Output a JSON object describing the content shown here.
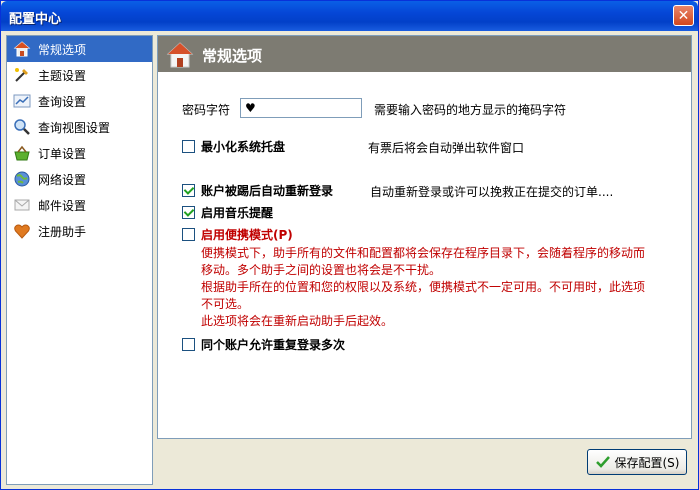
{
  "window": {
    "title": "配置中心",
    "close_glyph": "✕"
  },
  "sidebar": {
    "items": [
      {
        "label": "常规选项",
        "icon": "home-icon",
        "selected": true
      },
      {
        "label": "主题设置",
        "icon": "brush-icon"
      },
      {
        "label": "查询设置",
        "icon": "chart-icon"
      },
      {
        "label": "查询视图设置",
        "icon": "magnifier-icon"
      },
      {
        "label": "订单设置",
        "icon": "basket-icon"
      },
      {
        "label": "网络设置",
        "icon": "globe-icon"
      },
      {
        "label": "邮件设置",
        "icon": "envelope-icon"
      },
      {
        "label": "注册助手",
        "icon": "heart-icon"
      }
    ]
  },
  "panel": {
    "title": "常规选项",
    "password": {
      "label": "密码字符",
      "value": "♥",
      "description": "需要输入密码的地方显示的掩码字符"
    },
    "minimize_tray": {
      "label": "最小化系统托盘",
      "checked": false,
      "description": "有票后将会自动弹出软件窗口"
    },
    "auto_relogin": {
      "label": "账户被踢后自动重新登录",
      "checked": true,
      "description": "自动重新登录或许可以挽救正在提交的订单...."
    },
    "music_alert": {
      "label": "启用音乐提醒",
      "checked": true
    },
    "portable_mode": {
      "label": "启用便携模式(P)",
      "checked": false,
      "description": [
        "便携模式下，助手所有的文件和配置都将会保存在程序目录下，会随着程序的移动而",
        "移动。多个助手之间的设置也将会是不干扰。",
        "根据助手所在的位置和您的权限以及系统，便携模式不一定可用。不可用时，此选项",
        "不可选。",
        "此选项将会在重新启动助手后起效。"
      ]
    },
    "allow_multi_login": {
      "label": "同个账户允许重复登录多次",
      "checked": false
    }
  },
  "footer": {
    "save_label": "保存配置(S)"
  }
}
